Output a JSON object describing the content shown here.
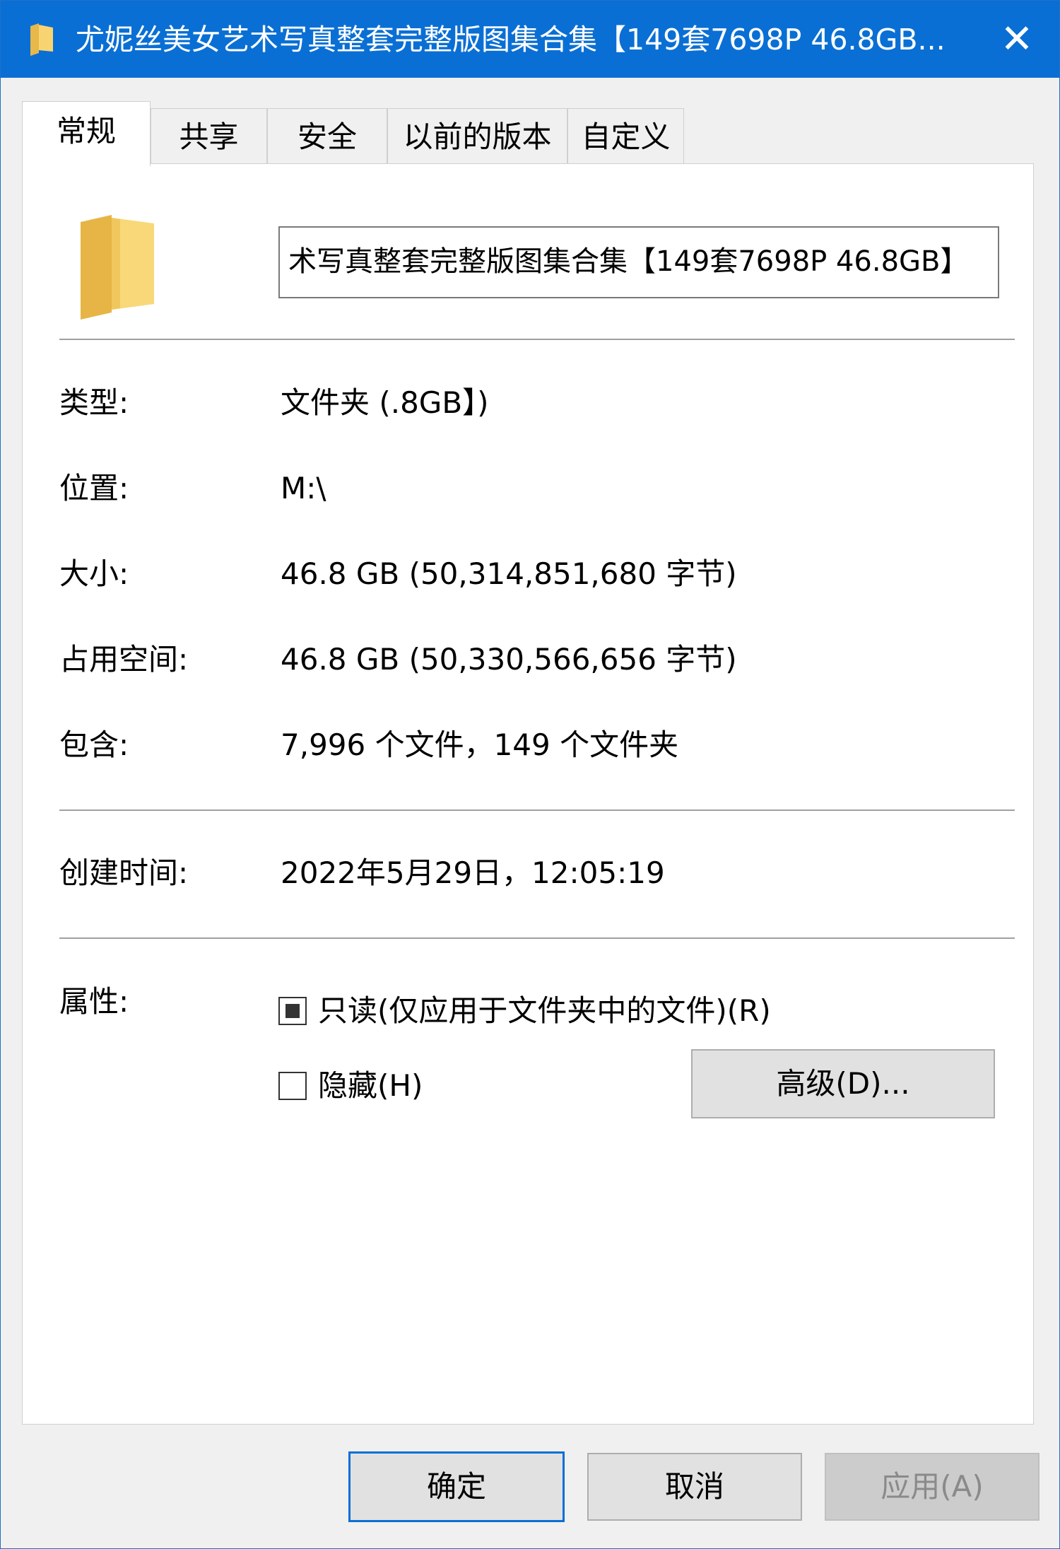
{
  "window": {
    "title": "尤妮丝美女艺术写真整套完整版图集合集【149套7698P 46.8GB...",
    "close_glyph": "✕",
    "accent_color": "#0a6fd4"
  },
  "tabs": [
    {
      "label": "常规",
      "active": true
    },
    {
      "label": "共享"
    },
    {
      "label": "安全"
    },
    {
      "label": "以前的版本"
    },
    {
      "label": "自定义"
    }
  ],
  "general": {
    "folder_icon": "folder-icon",
    "name_value": "术写真整套完整版图集合集【149套7698P 46.8GB】",
    "type_label": "类型:",
    "type_value": "文件夹 (.8GB】)",
    "location_label": "位置:",
    "location_value": "M:\\",
    "size_label": "大小:",
    "size_value": "46.8 GB (50,314,851,680 字节)",
    "disk_size_label": "占用空间:",
    "disk_size_value": "46.8 GB (50,330,566,656 字节)",
    "contains_label": "包含:",
    "contains_value": "7,996 个文件，149 个文件夹",
    "created_label": "创建时间:",
    "created_value": "2022年5月29日，12:05:19",
    "attributes_label": "属性:",
    "readonly_label": "只读(仅应用于文件夹中的文件)(R)",
    "readonly_state": "indeterminate",
    "hidden_label": "隐藏(H)",
    "hidden_state": "unchecked",
    "advanced_button": "高级(D)..."
  },
  "footer": {
    "ok_button": "确定",
    "cancel_button": "取消",
    "apply_button": "应用(A)"
  }
}
